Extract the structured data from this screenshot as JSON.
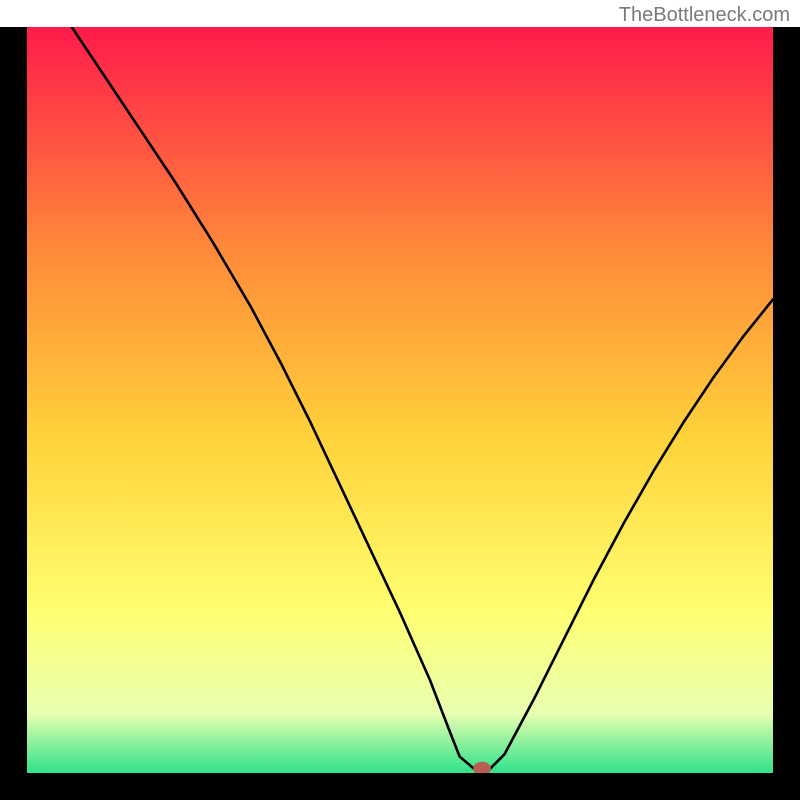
{
  "watermark": "TheBottleneck.com",
  "chart_data": {
    "type": "line",
    "title": "",
    "xlabel": "",
    "ylabel": "",
    "xlim": [
      0,
      100
    ],
    "ylim": [
      0,
      100
    ],
    "background_gradient": {
      "top": "#ff1a4a",
      "mid1": "#ff8a3a",
      "mid2": "#ffd23a",
      "mid3": "#ffff70",
      "mid4": "#e8ffb0",
      "bottom": "#2fe28a"
    },
    "series": [
      {
        "name": "curve",
        "x": [
          6,
          10,
          15,
          20,
          25,
          30,
          34,
          38,
          42,
          46,
          50,
          54,
          56.5,
          58,
          60,
          62,
          64,
          68,
          72,
          76,
          80,
          84,
          88,
          92,
          96,
          100
        ],
        "y": [
          100,
          94,
          86.5,
          79,
          71,
          62.5,
          55,
          47,
          38.5,
          30,
          21.5,
          12.5,
          6,
          2.2,
          0.5,
          0.5,
          2.5,
          10,
          18,
          26,
          33.5,
          40.5,
          47,
          53,
          58.5,
          63.5
        ]
      }
    ],
    "marker": {
      "x": 61,
      "y": 0.6,
      "rx": 1.2,
      "ry": 0.9,
      "color": "#b85f54"
    }
  }
}
